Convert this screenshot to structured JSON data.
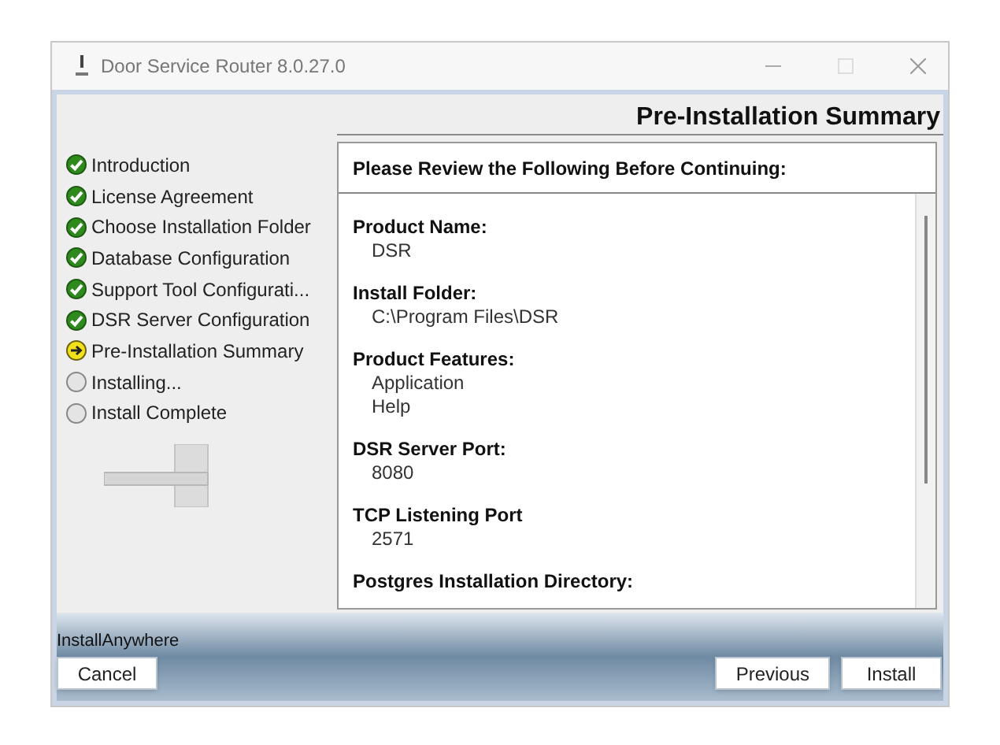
{
  "window": {
    "title": "Door Service Router 8.0.27.0"
  },
  "header": {
    "title": "Pre-Installation Summary"
  },
  "steps": [
    {
      "label": "Introduction",
      "kind": "done"
    },
    {
      "label": "License Agreement",
      "kind": "done"
    },
    {
      "label": "Choose Installation Folder",
      "kind": "done"
    },
    {
      "label": "Database Configuration",
      "kind": "done"
    },
    {
      "label": "Support Tool Configurati...",
      "kind": "done"
    },
    {
      "label": "DSR Server Configuration",
      "kind": "done"
    },
    {
      "label": "Pre-Installation Summary",
      "kind": "current"
    },
    {
      "label": "Installing...",
      "kind": "pending"
    },
    {
      "label": "Install Complete",
      "kind": "pending"
    }
  ],
  "summary": {
    "heading": "Please Review the Following Before Continuing:",
    "sections": [
      {
        "label": "Product Name:",
        "values": [
          "DSR"
        ]
      },
      {
        "label": "Install Folder:",
        "values": [
          "C:\\Program Files\\DSR"
        ]
      },
      {
        "label": "Product Features:",
        "values": [
          "Application",
          "Help"
        ]
      },
      {
        "label": "DSR Server Port:",
        "values": [
          "8080"
        ]
      },
      {
        "label": "TCP Listening Port",
        "values": [
          "2571"
        ]
      },
      {
        "label": "Postgres Installation Directory:"
      }
    ]
  },
  "footer": {
    "brand": "InstallAnywhere",
    "left_buttons": [
      "Cancel"
    ],
    "right_buttons": [
      "Previous",
      "Install"
    ]
  }
}
